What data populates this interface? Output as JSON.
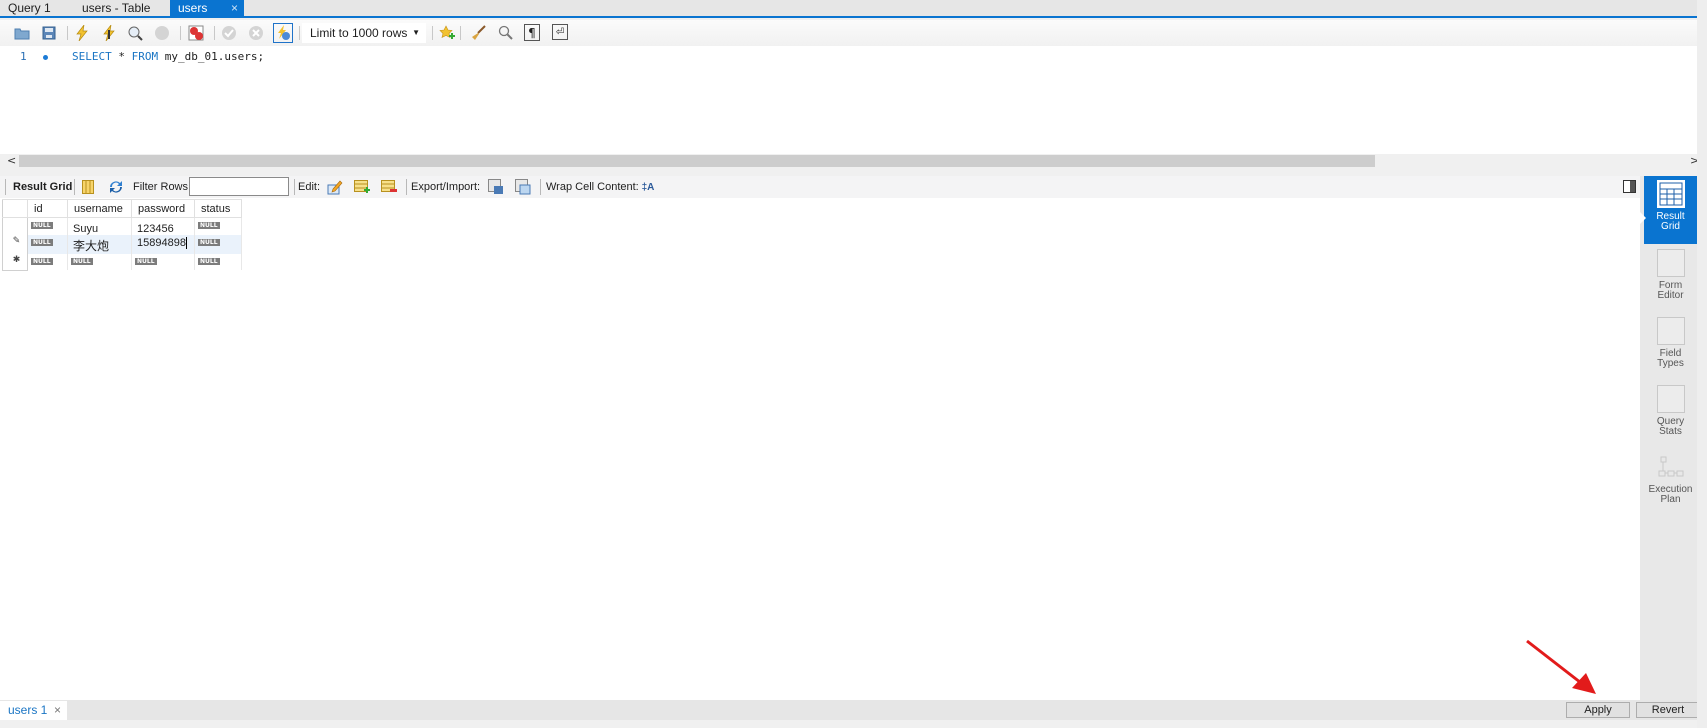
{
  "tabs": [
    {
      "label": "Query 1",
      "active": false
    },
    {
      "label": "users - Table",
      "active": false
    },
    {
      "label": "users",
      "active": true,
      "close": "×"
    }
  ],
  "toolbar": {
    "icons": [
      "open-folder-icon",
      "save-icon",
      "execute-icon",
      "execute-current-icon",
      "explain-icon",
      "stop-icon",
      "toggle-error-icon",
      "commit-icon",
      "rollback-icon",
      "autocommit-icon",
      "add-snippet-icon",
      "beautify-icon",
      "find-icon",
      "invisible-chars-icon",
      "wrap-lines-icon"
    ],
    "limit_select": {
      "value": "Limit to 1000 rows"
    }
  },
  "editor": {
    "line_number": "1",
    "code": {
      "kw1": "SELECT",
      "star": " * ",
      "kw2": "FROM",
      "rest": " my_db_01.users;"
    }
  },
  "scroll": {
    "left": "<",
    "right": ">"
  },
  "result_toolbar": {
    "result_grid_label": "Result Grid",
    "filter_label": "Filter Rows:",
    "filter_value": "",
    "edit_label": "Edit:",
    "export_label": "Export/Import:",
    "wrap_label": "Wrap Cell Content:"
  },
  "grid": {
    "columns": [
      "id",
      "username",
      "password",
      "status"
    ],
    "null_label": "NULL",
    "rows": [
      {
        "marker": "",
        "id": null,
        "username": "Suyu",
        "password": "123456",
        "status": null
      },
      {
        "marker": "✎",
        "id": null,
        "username": "李大炮",
        "password": "15894898",
        "status": null
      },
      {
        "marker": "✱",
        "id": null,
        "username": null,
        "password": null,
        "status": null
      }
    ]
  },
  "side_panel": [
    {
      "label1": "Result",
      "label2": "Grid",
      "active": true
    },
    {
      "label1": "Form",
      "label2": "Editor",
      "active": false
    },
    {
      "label1": "Field",
      "label2": "Types",
      "active": false
    },
    {
      "label1": "Query",
      "label2": "Stats",
      "active": false
    },
    {
      "label1": "Execution",
      "label2": "Plan",
      "active": false
    }
  ],
  "bottom": {
    "result_tab": "users 1",
    "close": "×",
    "apply_label": "Apply",
    "revert_label": "Revert"
  },
  "annotation": {
    "arrow_color": "#e21b1b"
  },
  "colors": {
    "accent": "#0a74d0",
    "keyword": "#1a75c4"
  }
}
